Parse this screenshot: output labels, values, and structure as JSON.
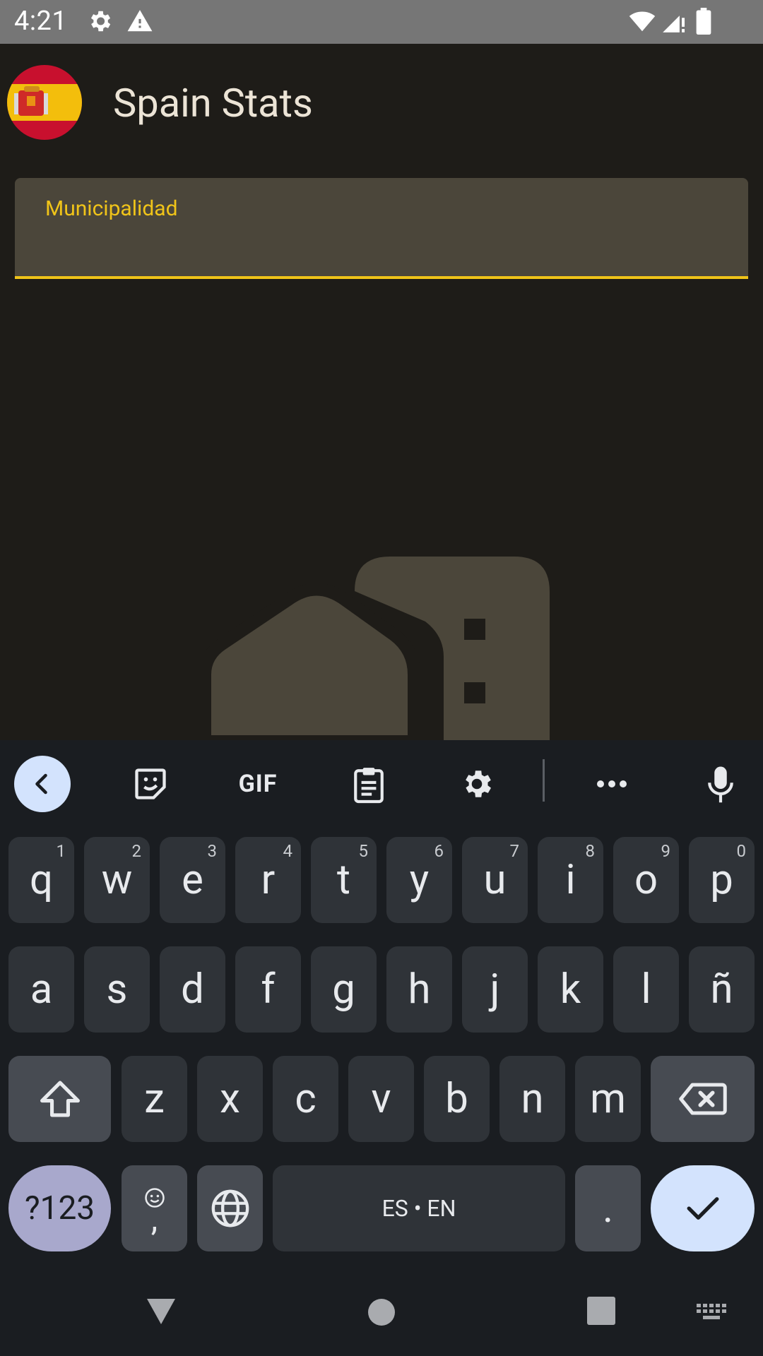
{
  "status_bar": {
    "time": "4:21",
    "icons": [
      "settings-icon",
      "warning-icon",
      "wifi-icon",
      "signal-icon",
      "battery-icon"
    ]
  },
  "app_bar": {
    "title": "Spain Stats",
    "logo": "spain-flag-icon"
  },
  "field": {
    "label": "Municipalidad",
    "value": ""
  },
  "keyboard": {
    "toolbar": [
      "back-chevron-icon",
      "sticker-icon",
      "GIF",
      "clipboard-icon",
      "gear-icon",
      "more-icon",
      "mic-icon"
    ],
    "row1": [
      {
        "k": "q",
        "h": "1"
      },
      {
        "k": "w",
        "h": "2"
      },
      {
        "k": "e",
        "h": "3"
      },
      {
        "k": "r",
        "h": "4"
      },
      {
        "k": "t",
        "h": "5"
      },
      {
        "k": "y",
        "h": "6"
      },
      {
        "k": "u",
        "h": "7"
      },
      {
        "k": "i",
        "h": "8"
      },
      {
        "k": "o",
        "h": "9"
      },
      {
        "k": "p",
        "h": "0"
      }
    ],
    "row2": [
      "a",
      "s",
      "d",
      "f",
      "g",
      "h",
      "j",
      "k",
      "l",
      "ñ"
    ],
    "row3": [
      "z",
      "x",
      "c",
      "v",
      "b",
      "n",
      "m"
    ],
    "symbols_label": "?123",
    "comma_label": ",",
    "space_label": "ES • EN",
    "period_label": "."
  },
  "colors": {
    "background": "#1e1c18",
    "accent": "#f0c419",
    "field_bg": "#4b463a",
    "key_bg": "#2f3338"
  }
}
